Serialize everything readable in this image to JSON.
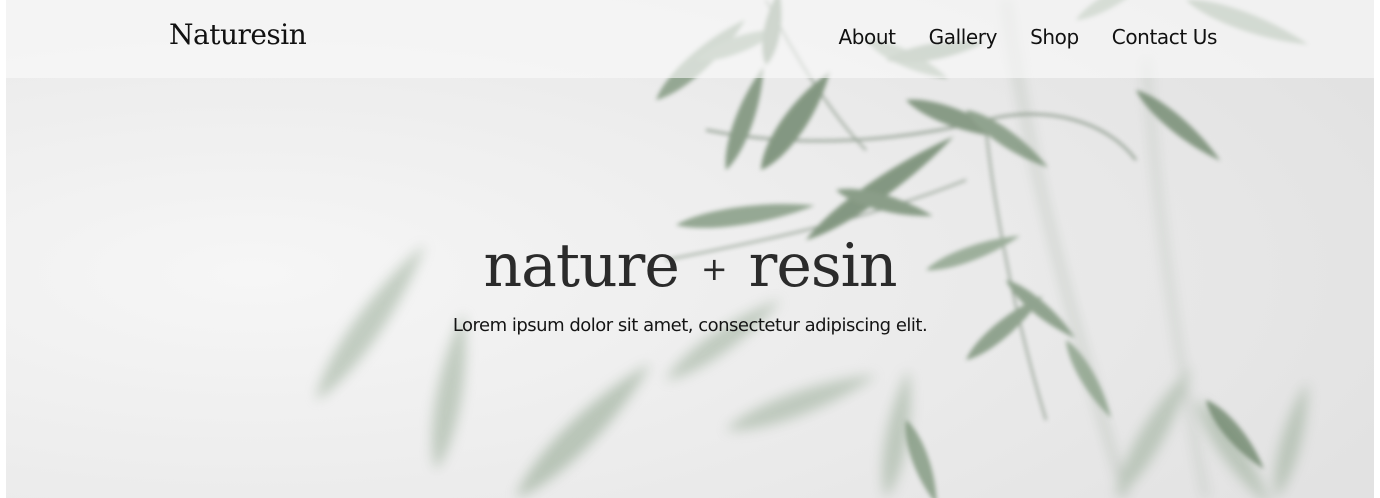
{
  "header": {
    "brand": "Naturesin",
    "nav": [
      {
        "label": "About"
      },
      {
        "label": "Gallery"
      },
      {
        "label": "Shop"
      },
      {
        "label": "Contact Us"
      }
    ]
  },
  "hero": {
    "title_left": "nature",
    "title_plus": "+",
    "title_right": "resin",
    "subtitle": "Lorem ipsum dolor sit amet, consectetur adipiscing elit.",
    "background_image": "blurred-olive-leaves-photo"
  },
  "colors": {
    "leaf": "#8fa58f",
    "leaf_dark": "#6f876f",
    "background": "#ececec",
    "text": "#111111"
  }
}
